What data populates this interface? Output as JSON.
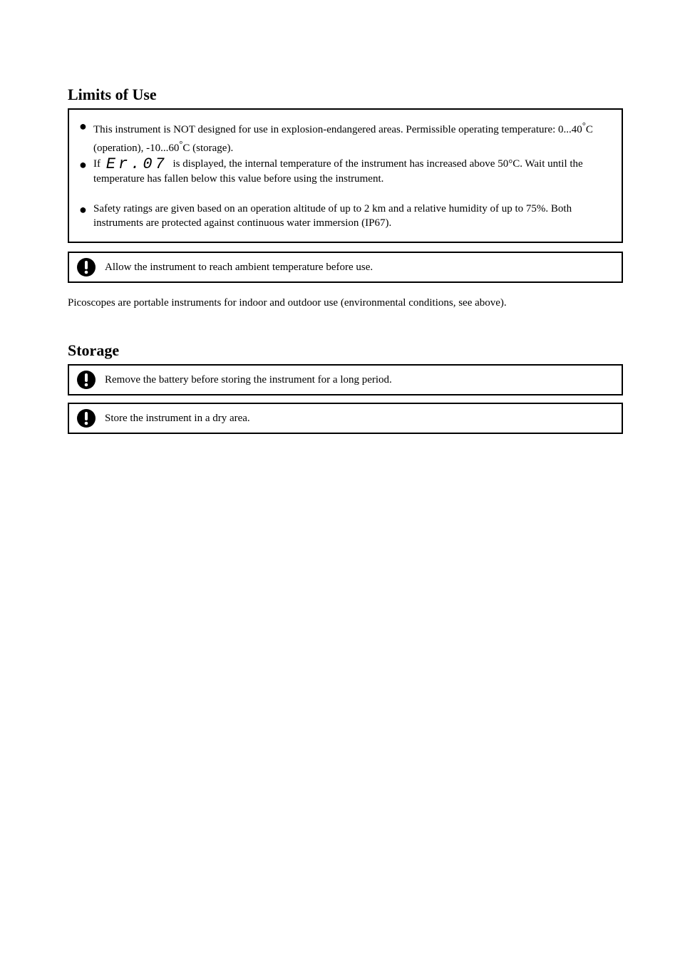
{
  "title": "Limits of Use",
  "bullets": [
    {
      "text_parts": [
        "This instrument is NOT designed for use in explosion-endangered areas. Permissible operating temperature: 0...40",
        "C (operation), -10...60",
        "C (storage)."
      ],
      "deg_after_index": [
        0,
        1
      ]
    },
    {
      "text_parts": [
        "If ",
        " is displayed, the internal temperature of the instrument has increased above 50°C. Wait until the temperature has fallen below this value before using the instrument."
      ],
      "code": "Er.07"
    },
    {
      "text_parts": [
        "Safety ratings are given based on an operation altitude of up to 2 km and a relative humidity of up to 75%. Both instruments are protected against continuous water immersion (IP67)."
      ]
    }
  ],
  "important_1": "Allow the instrument to reach ambient temperature before use.",
  "after_important_1": "Picoscopes are portable instruments for indoor and outdoor use (environmental conditions, see above).",
  "storage_title": "Storage",
  "important_storage_1": "Remove the battery before storing the instrument for a long period.",
  "important_storage_2": "Store the instrument in a dry area."
}
